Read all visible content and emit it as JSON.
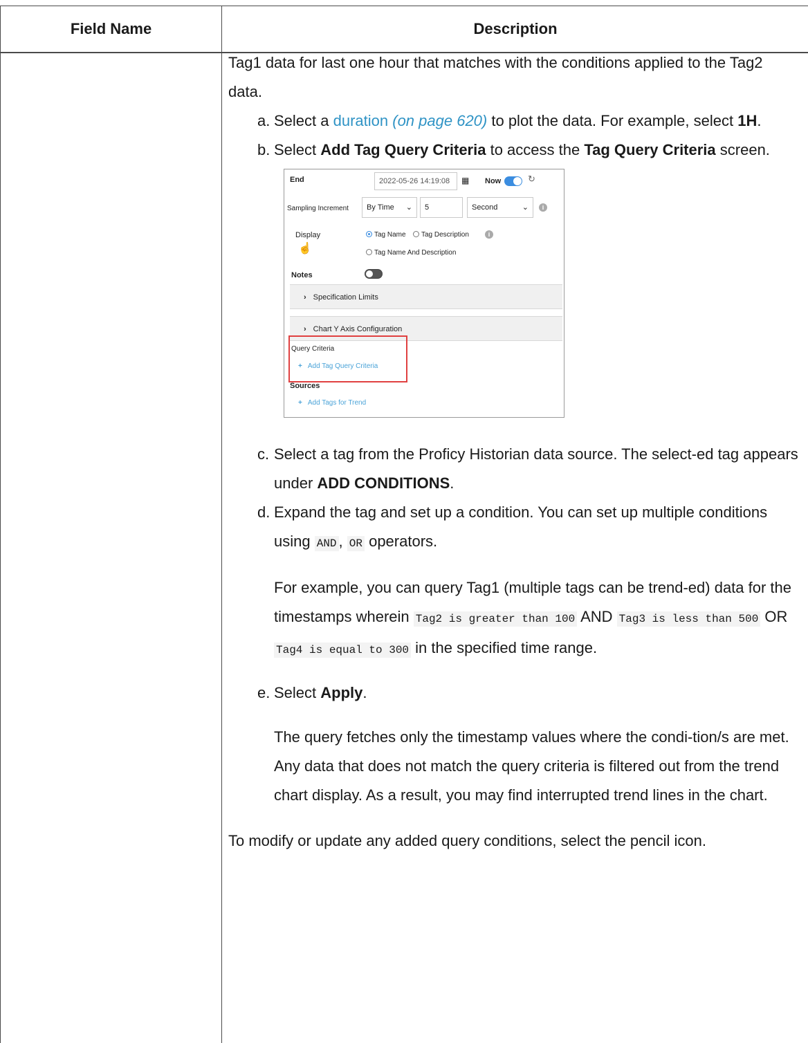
{
  "table": {
    "headers": {
      "field_name": "Field Name",
      "description": "Description"
    }
  },
  "description": {
    "intro": "Tag1 data for last one hour that matches with the conditions applied to the Tag2 data.",
    "steps": {
      "a": {
        "marker": "a.",
        "t1": "Select a ",
        "link": "duration",
        "link_ref": "(on page 620)",
        "t2": " to plot the data. For example, select ",
        "b1": "1H",
        "t3": "."
      },
      "b": {
        "marker": "b.",
        "t1": "Select ",
        "b1": "Add Tag Query Criteria",
        "t2": " to access the ",
        "b2": "Tag Query Criteria",
        "t3": " screen."
      },
      "c": {
        "marker": "c.",
        "t1": "Select a tag from the Proficy Historian data source. The select-ed tag appears under ",
        "b1": "ADD CONDITIONS",
        "t2": "."
      },
      "d": {
        "marker": "d.",
        "t1": "Expand the tag and set up a condition. You can set up multiple conditions using ",
        "c1": "AND",
        "t2": ", ",
        "c2": "OR",
        "t3": " operators.",
        "p2": {
          "t1": "For example, you can query Tag1 (multiple tags can be trend-ed) data for the timestamps wherein ",
          "c1": "Tag2 is greater than 100",
          "t2": " AND ",
          "c2": "Tag3 is less than 500",
          "t3": " OR ",
          "c3": "Tag4 is equal to 300",
          "t4": " in the specified time range."
        }
      },
      "e": {
        "marker": "e.",
        "t1": "Select ",
        "b1": "Apply",
        "t2": ".",
        "p2": "The query fetches only the timestamp values where the condi-tion/s are met. Any data that does not match the query criteria is filtered out from the trend chart display. As a result, you may find interrupted trend lines in the chart."
      }
    },
    "closing": "To modify or update any added query conditions, select the pencil icon."
  },
  "screenshot": {
    "end_label": "End",
    "end_value": "2022-05-26 14:19:08",
    "now_label": "Now",
    "sampling_label": "Sampling Increment",
    "sampling_mode": "By Time",
    "sampling_value": "5",
    "sampling_unit": "Second",
    "display_label": "Display",
    "opt_tag_name": "Tag Name",
    "opt_tag_desc": "Tag Description",
    "opt_tag_name_desc": "Tag Name And Description",
    "notes_label": "Notes",
    "spec_limits": "Specification Limits",
    "y_axis_config": "Chart Y Axis Configuration",
    "query_criteria_label": "Query Criteria",
    "add_tag_query": "Add Tag Query Criteria",
    "sources_label": "Sources",
    "add_tags_trend": "Add Tags for Trend",
    "icons": {
      "calendar": "calendar-icon",
      "refresh": "refresh-icon",
      "info": "info-icon",
      "hand": "hand-cursor-icon",
      "chevron": "chevron-right-icon",
      "plus": "plus-icon"
    },
    "colors": {
      "accent": "#3b8de0",
      "highlight": "#e04040",
      "link": "#2f93c5"
    }
  }
}
